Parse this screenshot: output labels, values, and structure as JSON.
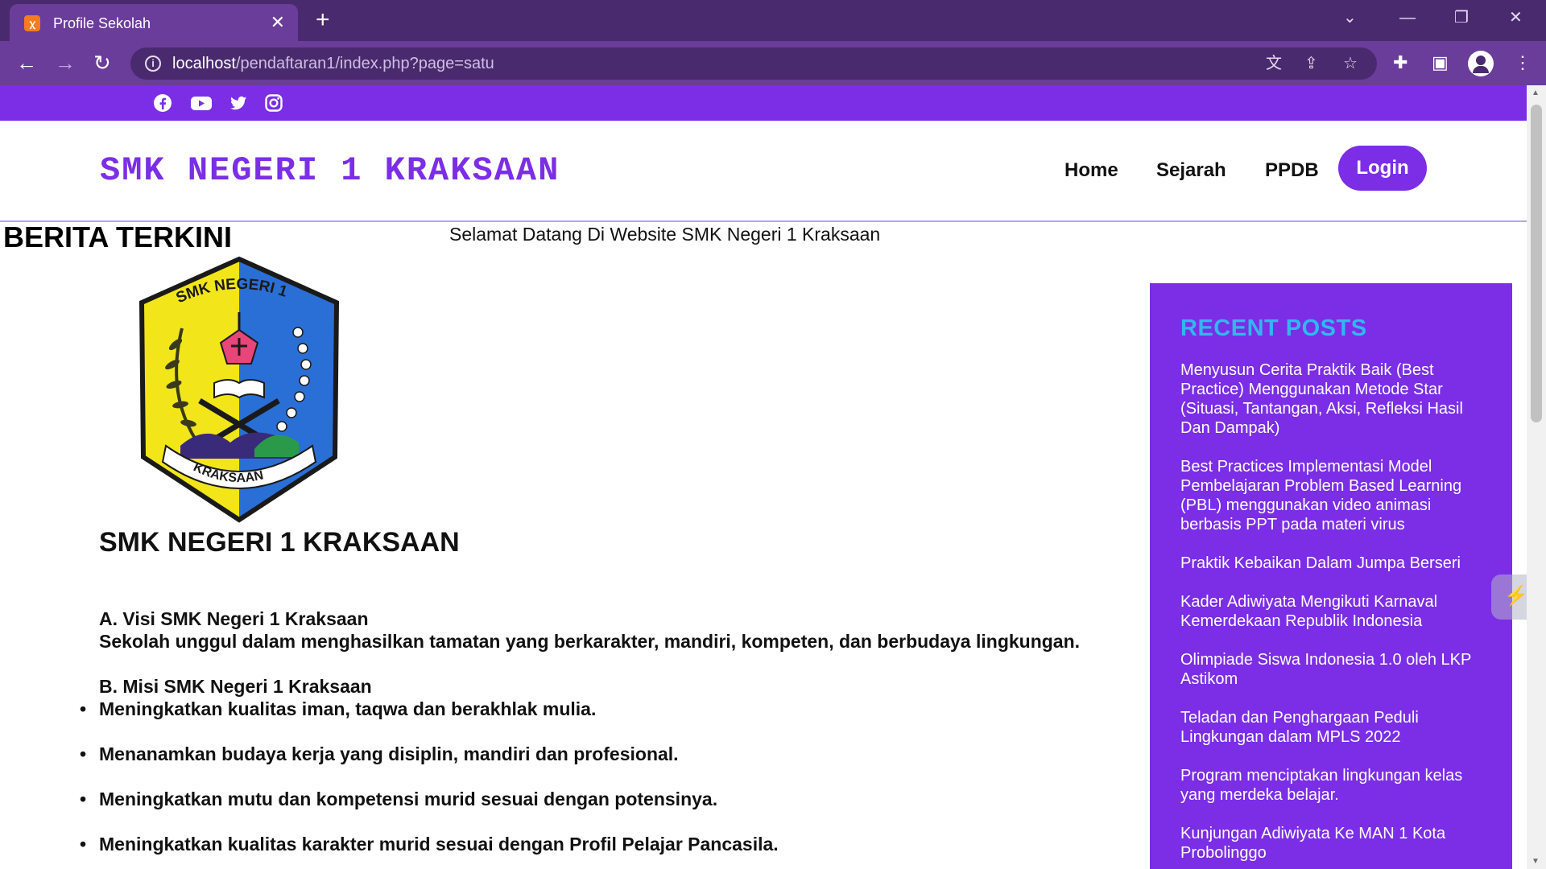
{
  "browser": {
    "tab_title": "Profile Sekolah",
    "tab_close": "✕",
    "new_tab": "+",
    "url_host": "localhost",
    "url_path": "/pendaftaran1/index.php?page=satu",
    "icons": [
      "back-icon",
      "forward-icon",
      "reload-icon",
      "info-icon",
      "translate-icon",
      "share-icon",
      "star-icon",
      "extensions-icon",
      "sidepanel-icon",
      "profile-icon",
      "menu-icon"
    ]
  },
  "social": {
    "icons": [
      "facebook-icon",
      "youtube-icon",
      "twitter-icon",
      "instagram-icon"
    ]
  },
  "header": {
    "brand": "SMK NEGERI 1 KRAKSAAN",
    "nav": {
      "home": "Home",
      "sejarah": "Sejarah",
      "ppdb": "PPDB",
      "login": "Login"
    }
  },
  "main": {
    "news_title": "BERITA TERKINI",
    "welcome": "Selamat Datang Di Website SMK Negeri 1 Kraksaan",
    "crest": {
      "top_text": "SMK NEGERI 1",
      "ribbon_text": "KRAKSAAN",
      "colors": {
        "left": "#f2e61a",
        "right": "#2a6fd6",
        "outline": "#1a1a1a"
      }
    },
    "school_name": "SMK NEGERI 1 KRAKSAAN",
    "visi_title": "A. Visi SMK Negeri 1 Kraksaan",
    "visi_text": "Sekolah unggul dalam menghasilkan tamatan yang berkarakter, mandiri, kompeten, dan berbudaya lingkungan.",
    "misi_title": "B. Misi SMK Negeri 1 Kraksaan",
    "misi_items": [
      "Meningkatkan kualitas iman, taqwa dan berakhlak mulia.",
      "Menanamkan budaya kerja yang disiplin, mandiri dan profesional.",
      "Meningkatkan mutu dan kompetensi murid sesuai dengan potensinya.",
      "Meningkatkan kualitas karakter murid sesuai dengan Profil Pelajar Pancasila."
    ]
  },
  "sidebar": {
    "title": "RECENT POSTS",
    "posts": [
      "Menyusun Cerita Praktik Baik (Best Practice) Menggunakan Metode Star (Situasi, Tantangan, Aksi, Refleksi Hasil Dan Dampak)",
      "Best Practices Implementasi Model Pembelajaran Problem Based Learning (PBL) menggunakan video animasi berbasis PPT pada materi virus",
      "Praktik Kebaikan Dalam Jumpa Berseri",
      "Kader Adiwiyata Mengikuti Karnaval Kemerdekaan Republik Indonesia",
      "Olimpiade Siswa Indonesia 1.0 oleh LKP Astikom",
      "Teladan dan Penghargaan Peduli Lingkungan dalam MPLS 2022",
      "Program menciptakan lingkungan kelas yang merdeka belajar.",
      "Kunjungan Adiwiyata Ke MAN 1 Kota Probolinggo"
    ]
  },
  "colors": {
    "accent": "#7b2ee6",
    "sidebar_title": "#2fb8f0",
    "chrome_dark": "#4a2a6e",
    "chrome": "#6a3d9a"
  }
}
